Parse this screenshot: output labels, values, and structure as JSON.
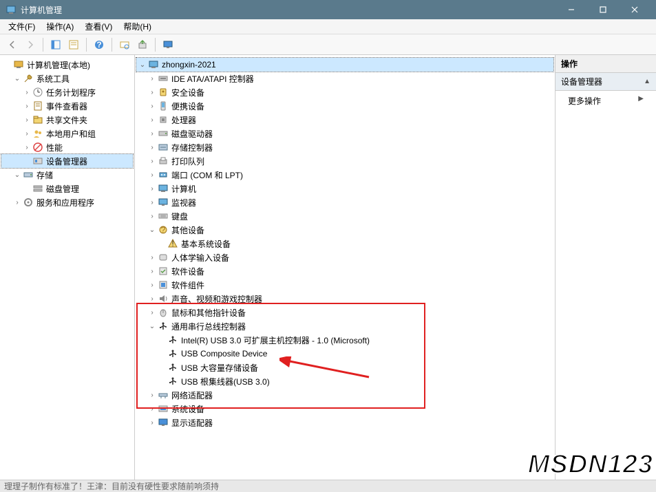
{
  "window": {
    "title": "计算机管理"
  },
  "menubar": [
    "文件(F)",
    "操作(A)",
    "查看(V)",
    "帮助(H)"
  ],
  "left_tree": [
    {
      "indent": 0,
      "chev": "",
      "icon": "computer-mgmt",
      "label": "计算机管理(本地)"
    },
    {
      "indent": 1,
      "chev": "v",
      "icon": "tools",
      "label": "系统工具"
    },
    {
      "indent": 2,
      "chev": ">",
      "icon": "scheduler",
      "label": "任务计划程序"
    },
    {
      "indent": 2,
      "chev": ">",
      "icon": "event",
      "label": "事件查看器"
    },
    {
      "indent": 2,
      "chev": ">",
      "icon": "shared",
      "label": "共享文件夹"
    },
    {
      "indent": 2,
      "chev": ">",
      "icon": "users",
      "label": "本地用户和组"
    },
    {
      "indent": 2,
      "chev": ">",
      "icon": "perf",
      "label": "性能"
    },
    {
      "indent": 2,
      "chev": "",
      "icon": "devmgr",
      "label": "设备管理器",
      "selected": true
    },
    {
      "indent": 1,
      "chev": "v",
      "icon": "storage",
      "label": "存储"
    },
    {
      "indent": 2,
      "chev": "",
      "icon": "diskmgmt",
      "label": "磁盘管理"
    },
    {
      "indent": 1,
      "chev": ">",
      "icon": "services",
      "label": "服务和应用程序"
    }
  ],
  "center_tree": [
    {
      "indent": 0,
      "chev": "v",
      "icon": "computer",
      "label": "zhongxin-2021",
      "selected": true
    },
    {
      "indent": 1,
      "chev": ">",
      "icon": "ide",
      "label": "IDE ATA/ATAPI 控制器"
    },
    {
      "indent": 1,
      "chev": ">",
      "icon": "security",
      "label": "安全设备"
    },
    {
      "indent": 1,
      "chev": ">",
      "icon": "portable",
      "label": "便携设备"
    },
    {
      "indent": 1,
      "chev": ">",
      "icon": "cpu",
      "label": "处理器"
    },
    {
      "indent": 1,
      "chev": ">",
      "icon": "disk",
      "label": "磁盘驱动器"
    },
    {
      "indent": 1,
      "chev": ">",
      "icon": "storage-ctrl",
      "label": "存储控制器"
    },
    {
      "indent": 1,
      "chev": ">",
      "icon": "printer",
      "label": "打印队列"
    },
    {
      "indent": 1,
      "chev": ">",
      "icon": "port",
      "label": "端口 (COM 和 LPT)"
    },
    {
      "indent": 1,
      "chev": ">",
      "icon": "computer",
      "label": "计算机"
    },
    {
      "indent": 1,
      "chev": ">",
      "icon": "monitor",
      "label": "监视器"
    },
    {
      "indent": 1,
      "chev": ">",
      "icon": "keyboard",
      "label": "键盘"
    },
    {
      "indent": 1,
      "chev": "v",
      "icon": "other",
      "label": "其他设备"
    },
    {
      "indent": 2,
      "chev": "",
      "icon": "warning",
      "label": "基本系统设备"
    },
    {
      "indent": 1,
      "chev": ">",
      "icon": "hid",
      "label": "人体学输入设备"
    },
    {
      "indent": 1,
      "chev": ">",
      "icon": "software",
      "label": "软件设备"
    },
    {
      "indent": 1,
      "chev": ">",
      "icon": "component",
      "label": "软件组件"
    },
    {
      "indent": 1,
      "chev": ">",
      "icon": "audio",
      "label": "声音、视频和游戏控制器"
    },
    {
      "indent": 1,
      "chev": ">",
      "icon": "mouse",
      "label": "鼠标和其他指针设备"
    },
    {
      "indent": 1,
      "chev": "v",
      "icon": "usb",
      "label": "通用串行总线控制器"
    },
    {
      "indent": 2,
      "chev": "",
      "icon": "usb",
      "label": "Intel(R) USB 3.0 可扩展主机控制器 - 1.0 (Microsoft)"
    },
    {
      "indent": 2,
      "chev": "",
      "icon": "usb",
      "label": "USB Composite Device"
    },
    {
      "indent": 2,
      "chev": "",
      "icon": "usb",
      "label": "USB 大容量存储设备"
    },
    {
      "indent": 2,
      "chev": "",
      "icon": "usb",
      "label": "USB 根集线器(USB 3.0)"
    },
    {
      "indent": 1,
      "chev": ">",
      "icon": "network",
      "label": "网络适配器"
    },
    {
      "indent": 1,
      "chev": ">",
      "icon": "system",
      "label": "系统设备"
    },
    {
      "indent": 1,
      "chev": ">",
      "icon": "display",
      "label": "显示适配器"
    }
  ],
  "right": {
    "header": "操作",
    "subheader": "设备管理器",
    "more": "更多操作"
  },
  "watermark": "MSDN123",
  "statusbar": "理理子制作有标准了！王津：目前没有硬性要求随前响须持"
}
